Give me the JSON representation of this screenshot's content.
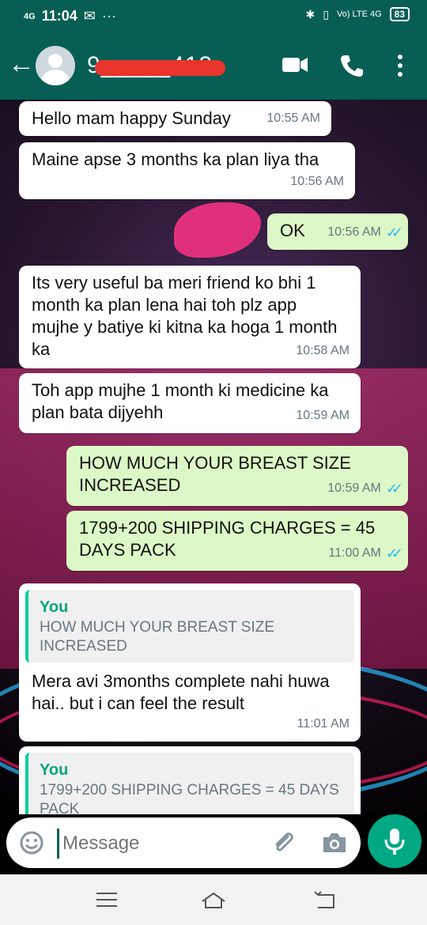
{
  "status": {
    "time": "11:04",
    "signal": "4G",
    "network": "Vo) LTE 4G",
    "battery": "83"
  },
  "header": {
    "contact": "9_____413"
  },
  "messages": [
    {
      "dir": "in",
      "text": "Hello mam happy Sunday",
      "time": "10:55 AM"
    },
    {
      "dir": "in",
      "text": "Maine apse 3 months ka plan liya tha",
      "time": "10:56 AM"
    },
    {
      "dir": "out",
      "text": "OK",
      "time": "10:56 AM"
    },
    {
      "dir": "in",
      "text": "Its very useful ba meri friend ko bhi 1 month ka plan lena hai toh plz app mujhe y batiye ki kitna ka hoga 1 month ka",
      "time": "10:58 AM"
    },
    {
      "dir": "in",
      "text": "Toh app mujhe 1 month ki medicine ka plan bata dijyehh",
      "time": "10:59 AM"
    },
    {
      "dir": "out",
      "text": "HOW MUCH YOUR BREAST SIZE INCREASED",
      "time": "10:59 AM"
    },
    {
      "dir": "out",
      "text": "1799+200 SHIPPING CHARGES = 45 DAYS PACK",
      "time": "11:00 AM"
    },
    {
      "dir": "in",
      "quote_author": "You",
      "quote_text": "HOW MUCH YOUR BREAST SIZE INCREASED",
      "text": "Mera avi 3months complete nahi huwa hai.. but i can feel the result",
      "time": "11:01 AM"
    },
    {
      "dir": "in",
      "quote_author": "You",
      "quote_text": "1799+200 SHIPPING CHARGES = 45 DAYS PACK"
    }
  ],
  "input": {
    "placeholder": "Message"
  },
  "icons": {
    "back": "arrow-left-icon",
    "video": "video-camera-icon",
    "call": "phone-icon",
    "more": "more-vert-icon",
    "emoji": "emoji-icon",
    "attach": "paperclip-icon",
    "camera": "camera-icon",
    "mic": "microphone-icon"
  },
  "colors": {
    "header": "#075e54",
    "outgoing": "#dcf8c6",
    "incoming": "#ffffff",
    "accent": "#00a884",
    "read_ticks": "#34b7f1"
  }
}
